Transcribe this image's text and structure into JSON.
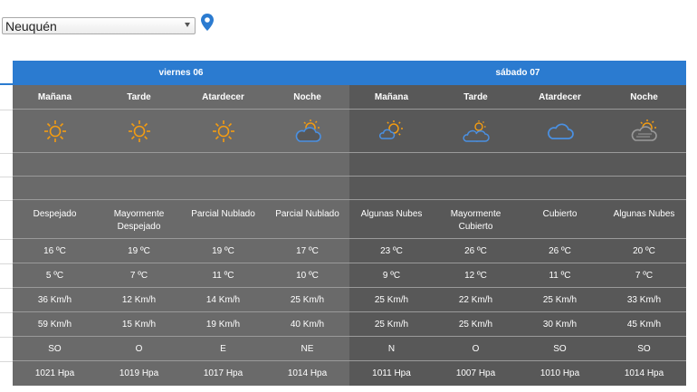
{
  "location_select": {
    "value": "Neuquén"
  },
  "days": [
    {
      "label": "viernes 06"
    },
    {
      "label": "sábado 07"
    }
  ],
  "periods": [
    {
      "name": "Mañana",
      "icon": "sun-icon",
      "desc": "Despejado",
      "temp_max": "16 ºC",
      "temp_min": "5 ºC",
      "wind": "36 Km/h",
      "gust": "59 Km/h",
      "dir": "SO",
      "pressure": "1021 Hpa"
    },
    {
      "name": "Tarde",
      "icon": "sun-icon",
      "desc": "Mayormente Despejado",
      "temp_max": "19 ºC",
      "temp_min": "7 ºC",
      "wind": "12 Km/h",
      "gust": "15 Km/h",
      "dir": "O",
      "pressure": "1019 Hpa"
    },
    {
      "name": "Atardecer",
      "icon": "sun-icon",
      "desc": "Parcial Nublado",
      "temp_max": "19 ºC",
      "temp_min": "11 ºC",
      "wind": "14 Km/h",
      "gust": "19 Km/h",
      "dir": "E",
      "pressure": "1017 Hpa"
    },
    {
      "name": "Noche",
      "icon": "sun-cloud-icon",
      "desc": "Parcial Nublado",
      "temp_max": "17 ºC",
      "temp_min": "10 ºC",
      "wind": "25 Km/h",
      "gust": "40 Km/h",
      "dir": "NE",
      "pressure": "1014 Hpa"
    },
    {
      "name": "Mañana",
      "icon": "sun-small-cloud-icon",
      "desc": "Algunas Nubes",
      "temp_max": "23 ºC",
      "temp_min": "9 ºC",
      "wind": "25 Km/h",
      "gust": "25 Km/h",
      "dir": "N",
      "pressure": "1011 Hpa"
    },
    {
      "name": "Tarde",
      "icon": "clouds-sun-icon",
      "desc": "Mayormente Cubierto",
      "temp_max": "26 ºC",
      "temp_min": "12 ºC",
      "wind": "22 Km/h",
      "gust": "25 Km/h",
      "dir": "O",
      "pressure": "1007 Hpa"
    },
    {
      "name": "Atardecer",
      "icon": "cloud-icon",
      "desc": "Cubierto",
      "temp_max": "26 ºC",
      "temp_min": "11 ºC",
      "wind": "25 Km/h",
      "gust": "30 Km/h",
      "dir": "SO",
      "pressure": "1010 Hpa"
    },
    {
      "name": "Noche",
      "icon": "sun-grey-cloud-icon",
      "desc": "Algunas Nubes",
      "temp_max": "20 ºC",
      "temp_min": "7 ºC",
      "wind": "33 Km/h",
      "gust": "45 Km/h",
      "dir": "SO",
      "pressure": "1014 Hpa"
    }
  ],
  "colors": {
    "header_blue": "#2b7bd0",
    "sun": "#f39c12",
    "cloud_blue": "#4a90e2",
    "cloud_grey": "#9a9a9a"
  }
}
